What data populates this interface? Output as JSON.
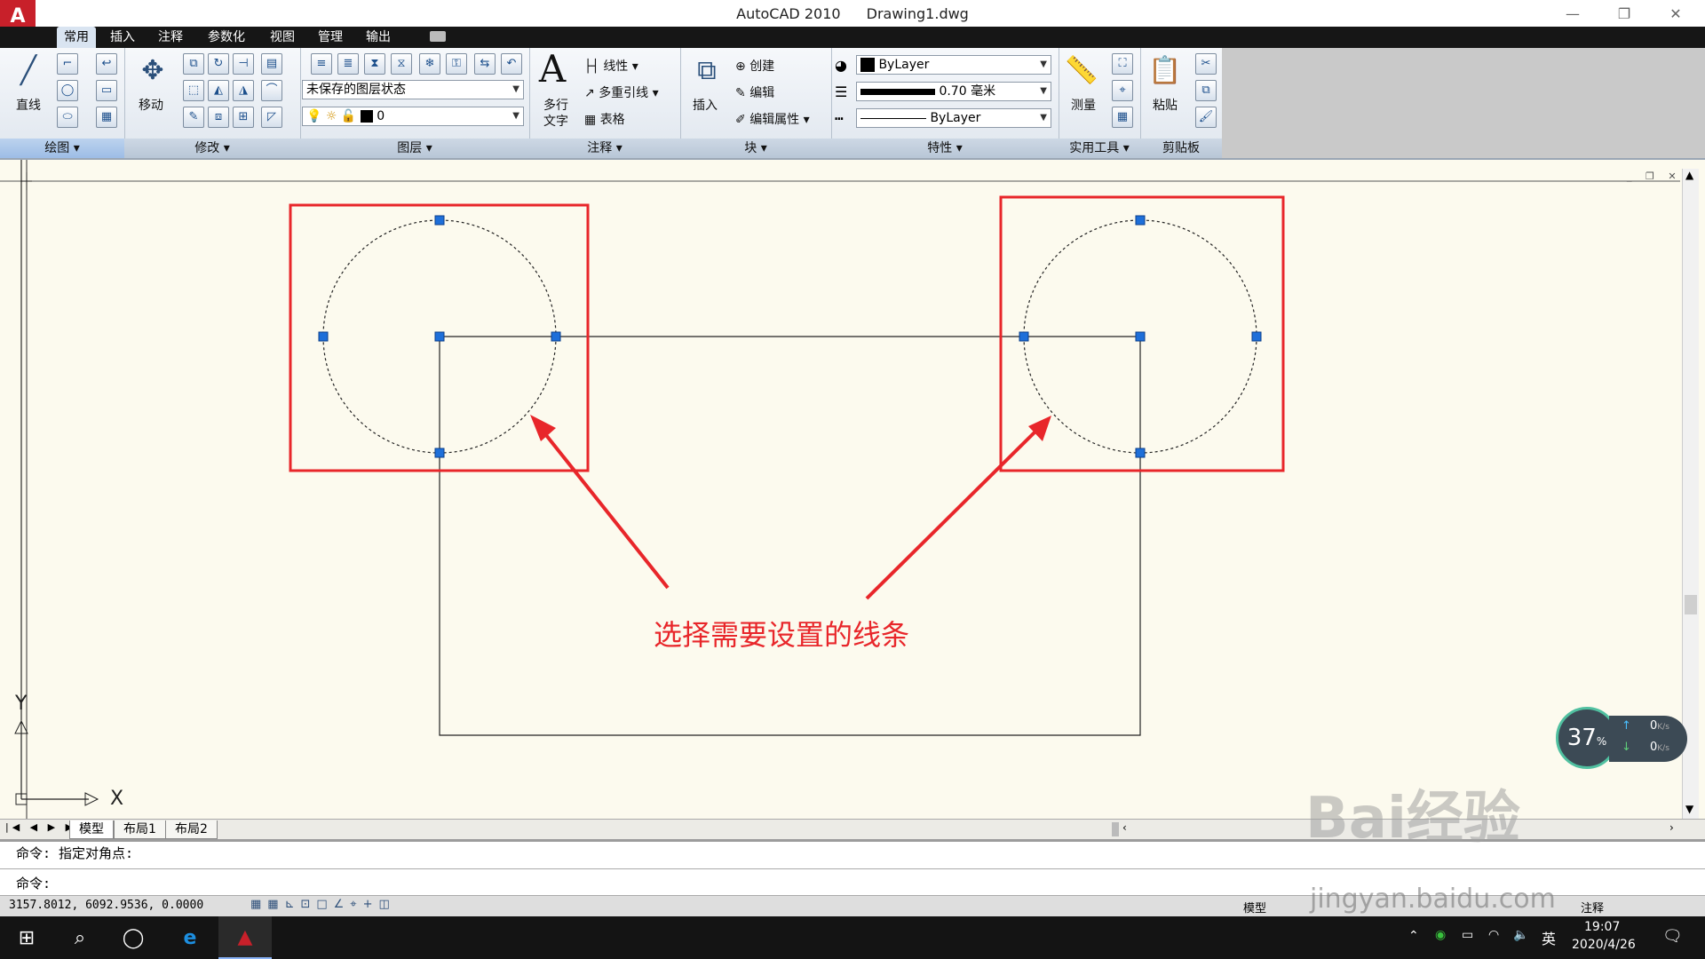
{
  "window": {
    "app_name": "AutoCAD 2010",
    "file_name": "Drawing1.dwg",
    "minimize": "—",
    "maximize": "❐",
    "close": "✕",
    "logo": "A"
  },
  "tabs": [
    "常用",
    "插入",
    "注释",
    "参数化",
    "视图",
    "管理",
    "输出"
  ],
  "ribbon": {
    "draw": {
      "line_label": "直线",
      "panel": "绘图 ▾"
    },
    "modify": {
      "move_label": "移动",
      "panel": "修改 ▾"
    },
    "layers": {
      "state_combo": "未保存的图层状态",
      "layer_combo": "0",
      "panel": "图层 ▾"
    },
    "annotation": {
      "mtext_label": "多行",
      "mtext_label2": "文字",
      "linear": "线性",
      "mleader": "多重引线",
      "table": "表格",
      "panel": "注释 ▾"
    },
    "block": {
      "insert": "插入",
      "create": "创建",
      "edit": "编辑",
      "edit_attr": "编辑属性",
      "panel": "块 ▾"
    },
    "properties": {
      "color": "ByLayer",
      "lineweight": "0.70 毫米",
      "linetype": "ByLayer",
      "panel": "特性 ▾"
    },
    "utilities": {
      "measure": "测量",
      "panel": "实用工具 ▾"
    },
    "clipboard": {
      "paste": "粘贴",
      "panel": "剪贴板"
    }
  },
  "canvas": {
    "annotation_text": "选择需要设置的线条",
    "annotation_color": "#e8262a",
    "ucs_x": "X",
    "ucs_y": "Y"
  },
  "layout_tabs": [
    "模型",
    "布局1",
    "布局2"
  ],
  "command": {
    "history": "命令: 指定对角点:",
    "prompt": "命令:"
  },
  "status": {
    "coords": "3157.8012,  6092.9536,  0.0000",
    "model": "模型",
    "annotation_scale": "注释"
  },
  "net_speed": {
    "percent": "37",
    "unit": "%",
    "up": "0",
    "down": "0",
    "rate_unit": "K/s"
  },
  "taskbar": {
    "ime": "英",
    "time": "19:07",
    "date": "2020/4/26"
  },
  "watermark": {
    "brand": "Bai经验",
    "url": "jingyan.baidu.com"
  }
}
